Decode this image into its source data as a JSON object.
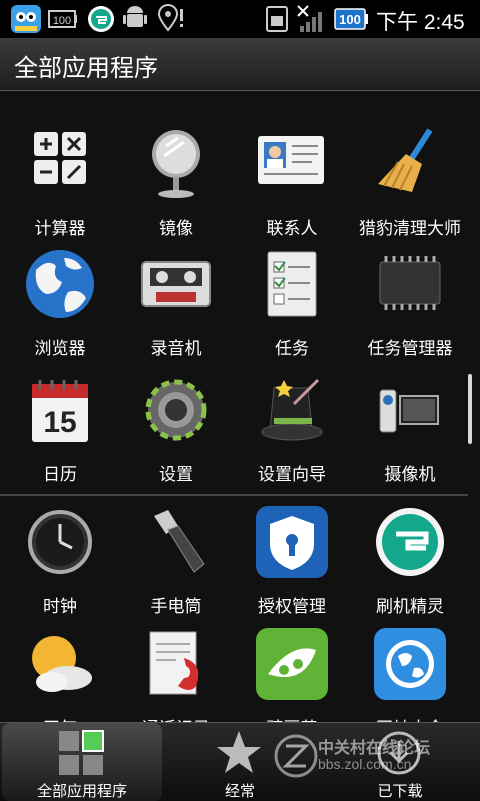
{
  "status_bar": {
    "battery_badge": "100",
    "battery_level": "100",
    "time": "下午 2:45"
  },
  "title": "全部应用程序",
  "apps": [
    {
      "label": "计算器",
      "icon": "calculator-icon"
    },
    {
      "label": "镜像",
      "icon": "mirror-icon"
    },
    {
      "label": "联系人",
      "icon": "contacts-icon"
    },
    {
      "label": "猎豹清理大师",
      "icon": "broom-icon"
    },
    {
      "label": "浏览器",
      "icon": "globe-icon"
    },
    {
      "label": "录音机",
      "icon": "cassette-icon"
    },
    {
      "label": "任务",
      "icon": "checklist-icon"
    },
    {
      "label": "任务管理器",
      "icon": "chip-icon"
    },
    {
      "label": "日历",
      "icon": "calendar-icon"
    },
    {
      "label": "设置",
      "icon": "gear-icon"
    },
    {
      "label": "设置向导",
      "icon": "magic-hat-icon"
    },
    {
      "label": "摄像机",
      "icon": "camcorder-icon"
    },
    {
      "label": "时钟",
      "icon": "clock-icon"
    },
    {
      "label": "手电筒",
      "icon": "flashlight-icon"
    },
    {
      "label": "授权管理",
      "icon": "shield-icon"
    },
    {
      "label": "刷机精灵",
      "icon": "flash-genie-icon"
    },
    {
      "label": "天气",
      "icon": "weather-icon"
    },
    {
      "label": "通话记录",
      "icon": "call-log-icon"
    },
    {
      "label": "豌豆荚",
      "icon": "pea-pod-icon"
    },
    {
      "label": "网址大全",
      "icon": "web-globe-icon"
    }
  ],
  "calendar_day": "15",
  "tabs": [
    {
      "label": "全部应用程序"
    },
    {
      "label": "经常"
    },
    {
      "label": "已下载"
    }
  ],
  "watermark": {
    "line1": "中关村在线论坛",
    "line2": "bbs.zol.com.cn"
  },
  "colors": {
    "accent": "#2f7fd8",
    "battery": "#1e73c9",
    "status_bg": "#000000"
  }
}
